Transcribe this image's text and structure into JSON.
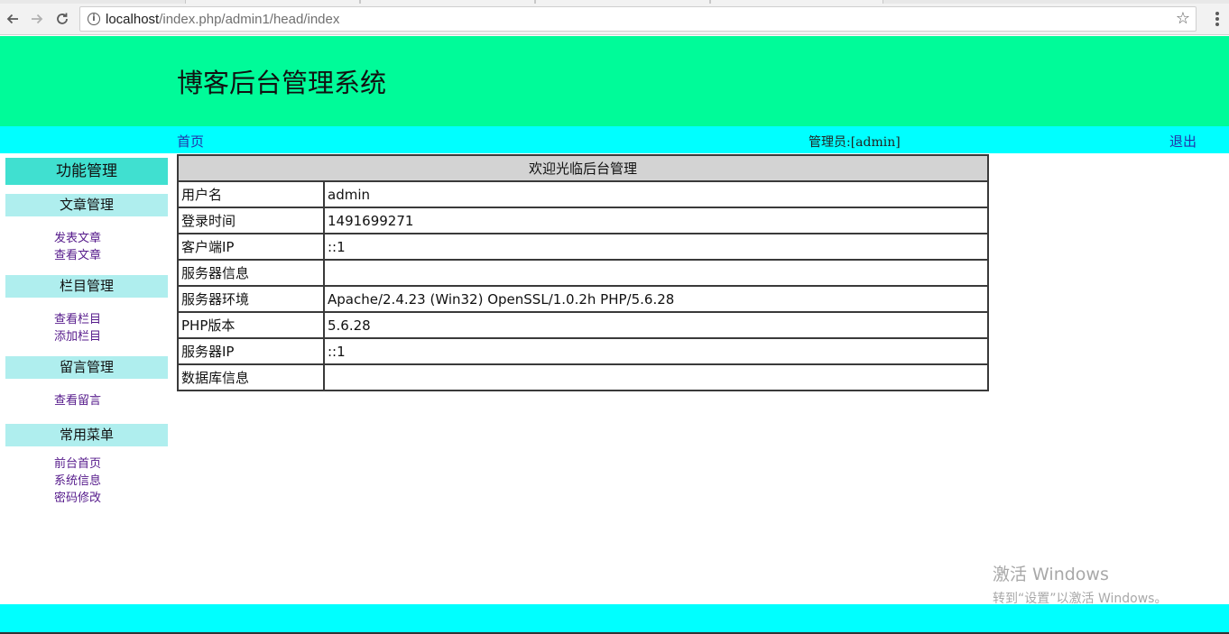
{
  "browser": {
    "url_host": "localhost",
    "url_path": "/index.php/admin1/head/index"
  },
  "header": {
    "title": "博客后台管理系统"
  },
  "topnav": {
    "home_label": "首页",
    "admin_label": "管理员:[admin]",
    "logout_label": "退出"
  },
  "sidebar": {
    "title": "功能管理",
    "groups": [
      {
        "label": "文章管理",
        "items": [
          "发表文章",
          "查看文章"
        ]
      },
      {
        "label": "栏目管理",
        "items": [
          "查看栏目",
          "添加栏目"
        ]
      },
      {
        "label": "留言管理",
        "items": [
          "查看留言"
        ]
      },
      {
        "label": "常用菜单",
        "items": [
          "前台首页",
          "系统信息",
          "密码修改"
        ]
      }
    ]
  },
  "info_table": {
    "caption": "欢迎光临后台管理",
    "rows": [
      {
        "key": "用户名",
        "value": "admin"
      },
      {
        "key": "登录时间",
        "value": "1491699271"
      },
      {
        "key": "客户端IP",
        "value": "::1"
      },
      {
        "key": "服务器信息",
        "value": ""
      },
      {
        "key": "服务器环境",
        "value": "Apache/2.4.23 (Win32) OpenSSL/1.0.2h PHP/5.6.28"
      },
      {
        "key": "PHP版本",
        "value": "5.6.28"
      },
      {
        "key": "服务器IP",
        "value": "::1"
      },
      {
        "key": "数据库信息",
        "value": ""
      }
    ]
  },
  "watermark": {
    "line1": "激活 Windows",
    "line2": "转到“设置”以激活 Windows。"
  },
  "colors": {
    "header_bg": "#00fb99",
    "nav_bg": "#00ffff",
    "sidebar_title_bg": "#40e0d0",
    "sidebar_group_bg": "#afeeee",
    "table_head_bg": "#d3d3d3"
  }
}
